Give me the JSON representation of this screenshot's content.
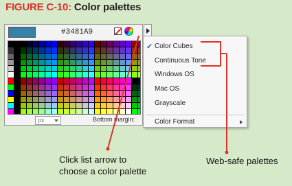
{
  "figure": {
    "label": "FIGURE C-10:",
    "title": "Color palettes"
  },
  "swatch_panel": {
    "hex_value": "#3481A9",
    "units_value": "px",
    "bottom_margin_label": "Bottom margin:",
    "preview_color": "#3481A9"
  },
  "palette_menu": {
    "items": [
      {
        "label": "Color Cubes",
        "checked": true
      },
      {
        "label": "Continuous Tone",
        "checked": false
      },
      {
        "label": "Windows OS",
        "checked": false
      },
      {
        "label": "Mac OS",
        "checked": false
      },
      {
        "label": "Grayscale",
        "checked": false
      }
    ],
    "submenu_item": {
      "label": "Color Format"
    }
  },
  "callouts": {
    "list_arrow": [
      "Click list arrow to",
      "choose a color palette"
    ],
    "web_safe": "Web-safe palettes"
  },
  "colors": {
    "accent_red": "#d9332b",
    "background": "#d6e9c8"
  }
}
